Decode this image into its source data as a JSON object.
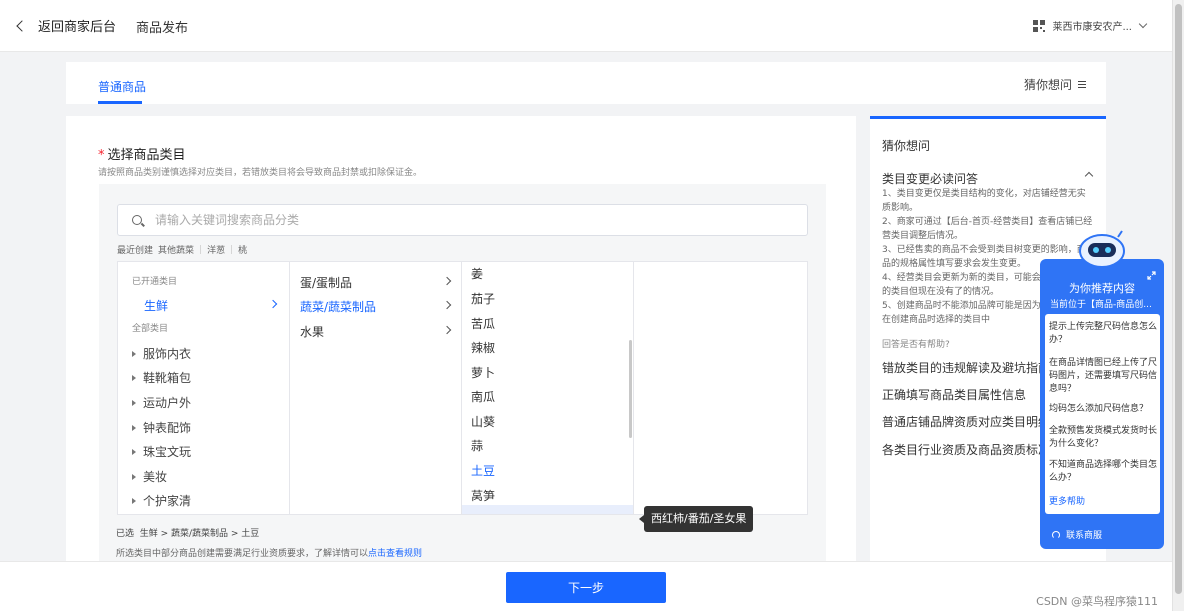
{
  "header": {
    "back_label": "返回商家后台",
    "page_title": "商品发布",
    "shop_name": "莱西市康安农产..."
  },
  "tabs": {
    "active": "普通商品",
    "guess": "猜你想问"
  },
  "category": {
    "required_mark": "*",
    "title": "选择商品类目",
    "description": "请按照商品类别谨慎选择对应类目，若错放类目将会导致商品封禁或扣除保证金。",
    "search_placeholder": "请输入关键词搜索商品分类",
    "recent_label": "最近创建",
    "recent_items": [
      "其他蔬菜",
      "洋葱",
      "桃"
    ],
    "col1": {
      "opened_group": "已开通类目",
      "selected": "生鲜",
      "all_group": "全部类目",
      "items": [
        "服饰内衣",
        "鞋靴箱包",
        "运动户外",
        "钟表配饰",
        "珠宝文玩",
        "美妆",
        "个护家清"
      ]
    },
    "col2": {
      "items": [
        "蛋/蛋制品",
        "蔬菜/蔬菜制品",
        "水果"
      ],
      "selected_index": 1
    },
    "col3": {
      "items": [
        "姜",
        "茄子",
        "苦瓜",
        "辣椒",
        "萝卜",
        "南瓜",
        "山葵",
        "蒜",
        "土豆",
        "莴笋"
      ],
      "selected_index": 8
    },
    "selected_prefix": "已选",
    "selected_path": "生鲜 > 蔬菜/蔬菜制品 > 土豆",
    "rules_text": "所选类目中部分商品创建需要满足行业资质要求，了解详情可以",
    "rules_link": "点击查看规则",
    "tooltip": "西红柿/番茄/圣女果"
  },
  "side": {
    "title": "猜你想问",
    "faq_title": "类目变更必读问答",
    "faq_lines": [
      "1、类目变更仅是类目结构的变化，对店铺经营无实质影响。",
      "2、商家可通过【后台-首页-经营类目】查看店铺已经营类目调整后情况。",
      "3、已经售卖的商品不会受到类目树变更的影响，商品的规格属性填写要求会发生变更。",
      "4、经营类目会更新为新的类目，可能会出现以使用的类目但现在没有了的情况。",
      "5、创建商品时不能添加品牌可能是因为类目不包含在创建商品时选择的类目中"
    ],
    "helpful": "回答是否有帮助?",
    "links": [
      "错放类目的违规解读及避坑指南",
      "正确填写商品类目属性信息",
      "普通店铺品牌资质对应类目明细表",
      "各类目行业资质及商品资质标准"
    ]
  },
  "assistant": {
    "title": "为你推荐内容",
    "subtitle": "当前位于【商品-商品创...",
    "questions": [
      "提示上传完整尺码信息怎么办？",
      "在商品详情图已经上传了尺码图片，还需要填写尺码信息吗？",
      "均码怎么添加尺码信息？",
      "全款预售发货模式发货时长为什么变化？",
      "不知道商品选择哪个类目怎么办？"
    ],
    "more": "更多帮助",
    "service": "联系商服"
  },
  "footer": {
    "next_label": "下一步",
    "watermark": "CSDN @菜鸟程序猿111"
  },
  "colors": {
    "primary": "#1966ff",
    "required": "#f5222d"
  }
}
